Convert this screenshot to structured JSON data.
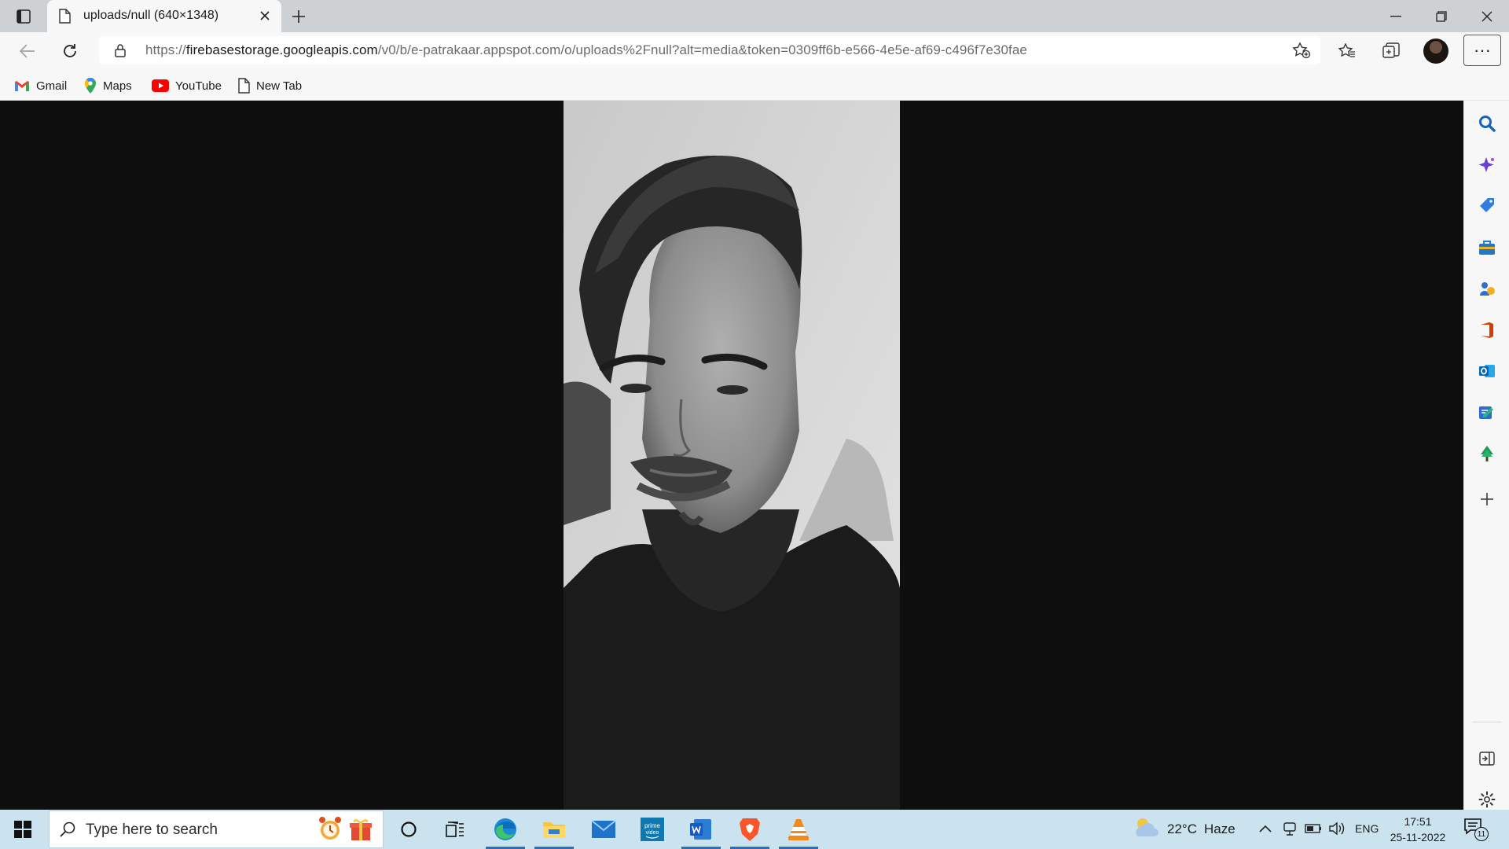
{
  "browser": {
    "tab": {
      "title": "uploads/null (640×1348)"
    },
    "address": {
      "prefix": "https://",
      "host": "firebasestorage.googleapis.com",
      "path": "/v0/b/e-patrakaar.appspot.com/o/uploads%2Fnull?alt=media&token=0309ff6b-e566-4e5e-af69-c496f7e30fae"
    },
    "favorites": [
      {
        "label": "Gmail",
        "icon": "gmail-icon"
      },
      {
        "label": "Maps",
        "icon": "maps-icon"
      },
      {
        "label": "YouTube",
        "icon": "youtube-icon"
      },
      {
        "label": "New Tab",
        "icon": "page-icon"
      }
    ],
    "more_label": "···"
  },
  "sidebar": {
    "icons": [
      "search-icon",
      "sparkle-icon",
      "tag-icon",
      "briefcase-icon",
      "games-icon",
      "office-icon",
      "outlook-icon",
      "drop-icon",
      "tree-icon",
      "add-icon",
      "collapse-sidebar-icon",
      "settings-icon"
    ]
  },
  "taskbar": {
    "search_placeholder": "Type here to search",
    "weather": {
      "temp": "22°C",
      "condition": "Haze"
    },
    "language": "ENG",
    "time": "17:51",
    "date": "25-11-2022",
    "notifications": "11",
    "apps": [
      "cortana-icon",
      "task-view-icon",
      "edge-icon",
      "file-explorer-icon",
      "mail-icon",
      "prime-video-icon",
      "word-icon",
      "brave-icon",
      "vlc-icon"
    ]
  },
  "colors": {
    "taskbar": "#cbe3ef",
    "titlebar": "#ced1d4",
    "toolbar": "#f7f7f7",
    "viewport": "#0e0e0e"
  }
}
